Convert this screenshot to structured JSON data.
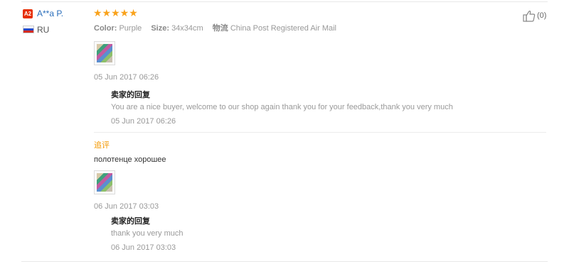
{
  "buyer": {
    "level_badge": "A2",
    "name": "A**a P.",
    "country": "RU"
  },
  "review": {
    "stars": "★★★★★",
    "rating": 5,
    "star_color": "#f9a21b",
    "attributes": [
      {
        "label": "Color:",
        "value": "Purple"
      },
      {
        "label": "Size:",
        "value": "34x34cm"
      },
      {
        "label": "物流",
        "value": "China Post Registered Air Mail"
      }
    ],
    "date": "05 Jun 2017 06:26",
    "helpful_count": "(0)",
    "seller_reply": {
      "title": "卖家的回复",
      "text": "You are a nice buyer, welcome to our shop again thank you for your feedback,thank you very much",
      "date": "05 Jun 2017 06:26"
    }
  },
  "additional_feedback": {
    "label": "追评",
    "label_color": "#f39800",
    "text": "полотенце хорошее",
    "date": "06 Jun 2017 03:03",
    "seller_reply": {
      "title": "卖家的回复",
      "text": "thank you very much",
      "date": "06 Jun 2017 03:03"
    }
  },
  "colors": {
    "link": "#2a6ebb",
    "badge": "#e62e04"
  }
}
